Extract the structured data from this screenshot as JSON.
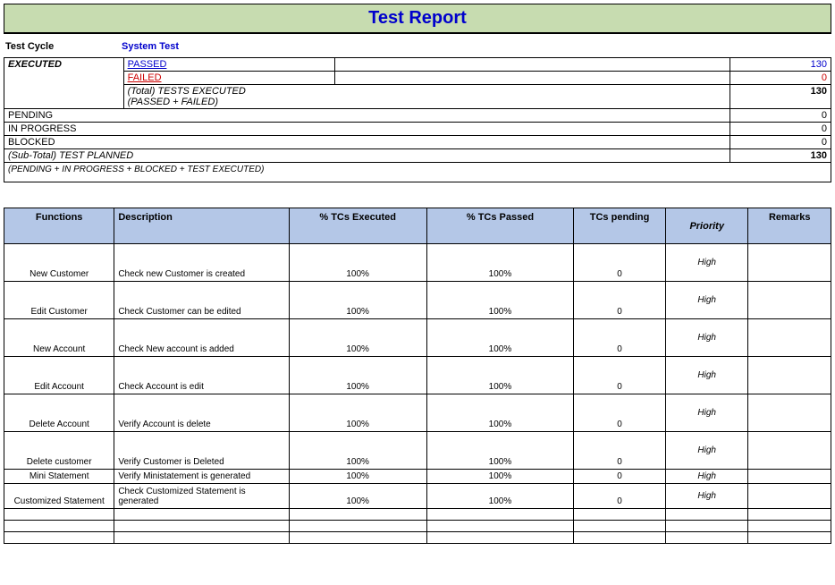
{
  "title": "Test Report",
  "test_cycle_label": "Test Cycle",
  "test_cycle_value": "System Test",
  "summary": {
    "executed_label": "EXECUTED",
    "passed_label": "PASSED",
    "passed_value": "130",
    "failed_label": "FAILED",
    "failed_value": "0",
    "total_exec_label": "(Total) TESTS EXECUTED",
    "total_exec_sub": "(PASSED + FAILED)",
    "total_exec_value": "130",
    "pending_label": "PENDING",
    "pending_value": "0",
    "inprogress_label": "IN PROGRESS",
    "inprogress_value": "0",
    "blocked_label": "BLOCKED",
    "blocked_value": "0",
    "subtotal_label": "(Sub-Total) TEST PLANNED",
    "subtotal_value": "130",
    "formula_note": "(PENDING + IN PROGRESS + BLOCKED + TEST EXECUTED)"
  },
  "headers": {
    "functions": "Functions",
    "description": "Description",
    "exec": "% TCs Executed",
    "passed": "% TCs Passed",
    "pending": "TCs pending",
    "priority": "Priority",
    "remarks": "Remarks"
  },
  "rows": [
    {
      "fn": "New Customer",
      "desc": "Check new Customer is created",
      "exec": "100%",
      "pass": "100%",
      "pend": "0",
      "prio": "High",
      "rem": "",
      "tall": true
    },
    {
      "fn": "Edit Customer",
      "desc": "Check Customer can be edited",
      "exec": "100%",
      "pass": "100%",
      "pend": "0",
      "prio": "High",
      "rem": "",
      "tall": true
    },
    {
      "fn": "New Account",
      "desc": "Check New account is added",
      "exec": "100%",
      "pass": "100%",
      "pend": "0",
      "prio": "High",
      "rem": "",
      "tall": true
    },
    {
      "fn": "Edit Account",
      "desc": "Check Account is edit",
      "exec": "100%",
      "pass": "100%",
      "pend": "0",
      "prio": "High",
      "rem": "",
      "tall": true
    },
    {
      "fn": "Delete Account",
      "desc": "Verify Account is delete",
      "exec": "100%",
      "pass": "100%",
      "pend": "0",
      "prio": "High",
      "rem": "",
      "tall": true
    },
    {
      "fn": "Delete customer",
      "desc": "Verify Customer is Deleted",
      "exec": "100%",
      "pass": "100%",
      "pend": "0",
      "prio": "High",
      "rem": "",
      "tall": true
    },
    {
      "fn": "Mini Statement",
      "desc": "Verify Ministatement is generated",
      "exec": "100%",
      "pass": "100%",
      "pend": "0",
      "prio": "High",
      "rem": "",
      "tall": false
    },
    {
      "fn": "Customized Statement",
      "desc": "Check Customized Statement is generated",
      "exec": "100%",
      "pass": "100%",
      "pend": "0",
      "prio": "High",
      "rem": "",
      "tall": true,
      "medium": true
    }
  ]
}
